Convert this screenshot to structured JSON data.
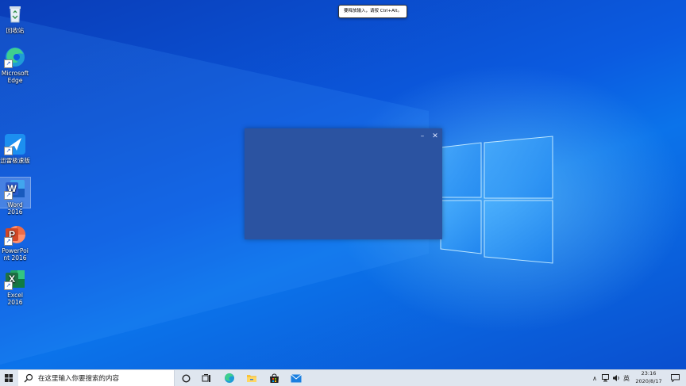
{
  "desktop": {
    "icons": [
      {
        "label": "回收站"
      },
      {
        "label": "Microsoft Edge"
      },
      {
        "label": "迅雷极速版"
      },
      {
        "label": "Word 2016"
      },
      {
        "label": "PowerPoint 2016"
      },
      {
        "label": "Excel 2016"
      }
    ],
    "tooltip": "要释放输入，请按 Ctrl+Alt。"
  },
  "dialog": {
    "minimize_glyph": "–",
    "close_glyph": "✕"
  },
  "taskbar": {
    "search_placeholder": "在这里输入你要搜索的内容",
    "pinned": [
      "task-view-icon",
      "edge-icon",
      "file-explorer-icon",
      "store-icon",
      "mail-icon"
    ],
    "tray": {
      "chevron": "∧",
      "ime": "英",
      "time": "23:16",
      "date": "2020/8/17"
    }
  },
  "colors": {
    "wallpaper": "#0b5be0",
    "dialog": "#2b53a1",
    "taskbar": "#dfe6ef",
    "word": "#2b5ccc",
    "powerpoint": "#d24726",
    "excel": "#1e7145"
  }
}
